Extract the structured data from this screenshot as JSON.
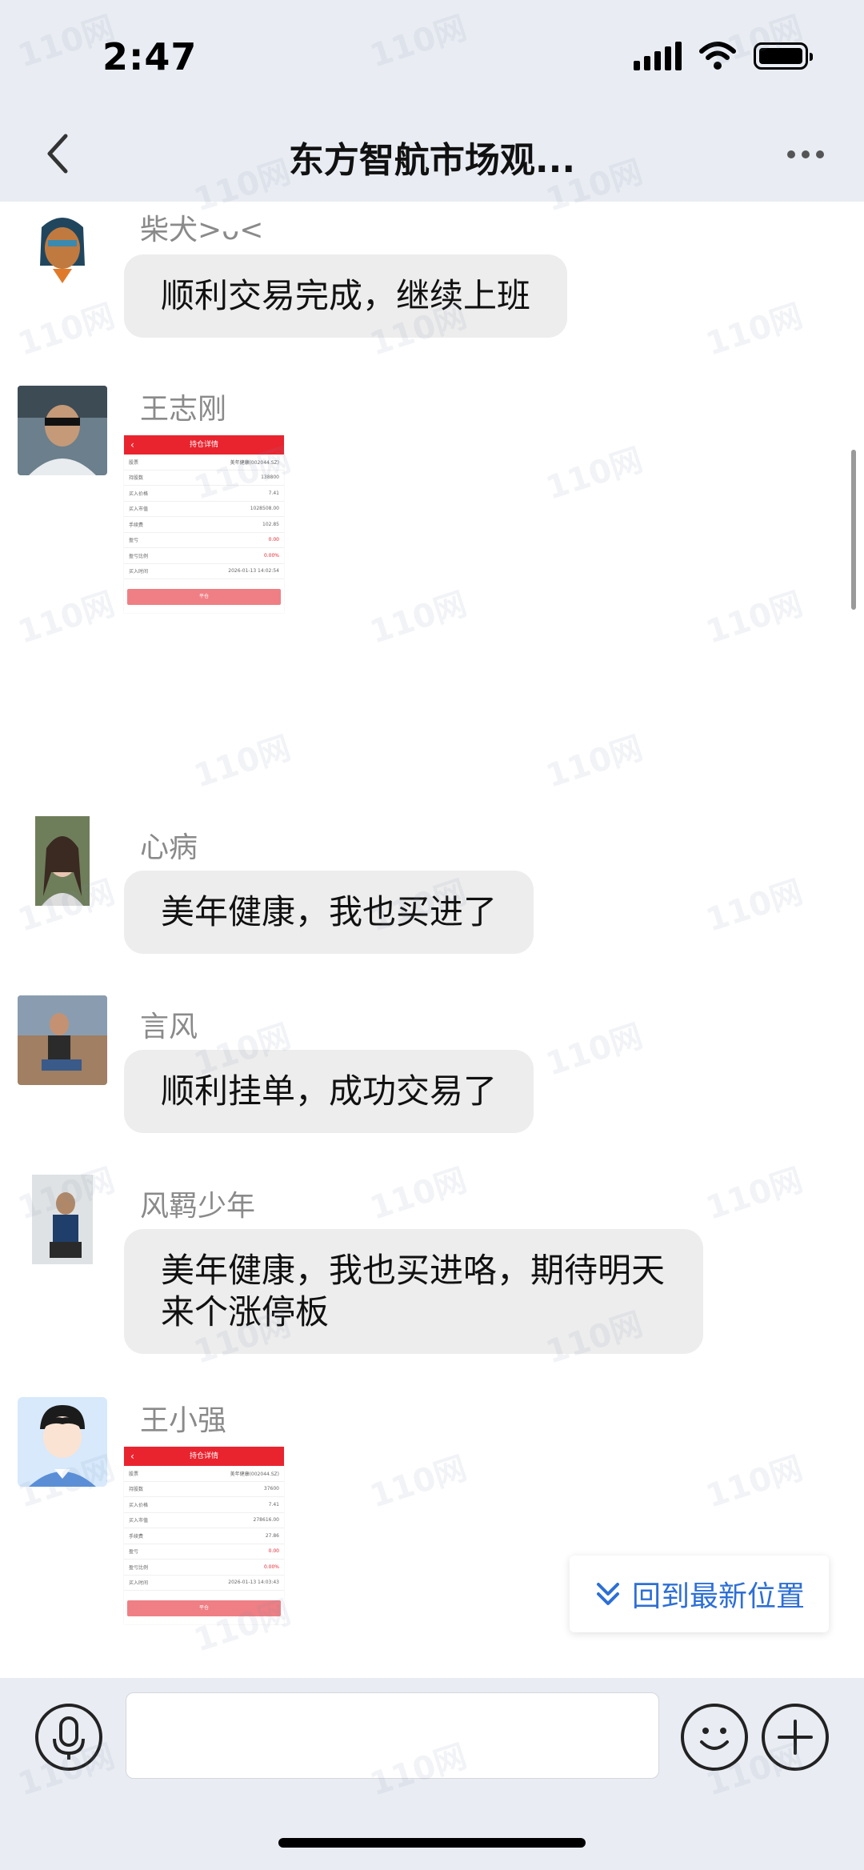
{
  "status": {
    "time": "2:47"
  },
  "nav": {
    "title": "东方智航市场观..."
  },
  "messages": [
    {
      "sender": "柴犬>ᴗ<",
      "text": "顺利交易完成，继续上班"
    },
    {
      "sender": "王志刚",
      "attachment": {
        "header": "持仓详情",
        "rows": [
          [
            "股票",
            "美年健康(002044.SZ)"
          ],
          [
            "持股数",
            "138800"
          ],
          [
            "买入价格",
            "7.41"
          ],
          [
            "买入市值",
            "1028508.00"
          ],
          [
            "手续费",
            "102.85"
          ],
          [
            "盈亏",
            "0.00"
          ],
          [
            "盈亏比例",
            "0.00%"
          ],
          [
            "买入时间",
            "2026-01-13 14:02:54"
          ]
        ],
        "button": "平仓"
      }
    },
    {
      "sender": "心病",
      "text": "美年健康，我也买进了"
    },
    {
      "sender": "言风",
      "text": "顺利挂单，成功交易了"
    },
    {
      "sender": "风羁少年",
      "text": "美年健康，我也买进咯，期待明天来个涨停板"
    },
    {
      "sender": "王小强",
      "attachment": {
        "header": "持仓详情",
        "rows": [
          [
            "股票",
            "美年健康(002044.SZ)"
          ],
          [
            "持股数",
            "37600"
          ],
          [
            "买入价格",
            "7.41"
          ],
          [
            "买入市值",
            "278616.00"
          ],
          [
            "手续费",
            "27.86"
          ],
          [
            "盈亏",
            "0.00"
          ],
          [
            "盈亏比例",
            "0.00%"
          ],
          [
            "买入时间",
            "2026-01-13 14:03:43"
          ]
        ],
        "button": "平仓"
      }
    }
  ],
  "jump_latest": {
    "label": "回到最新位置"
  },
  "watermark": "110网",
  "colors": {
    "accent": "#2d6fd6",
    "header_red": "#e9242f",
    "bubble": "#ededed",
    "chrome": "#e9edf3"
  }
}
